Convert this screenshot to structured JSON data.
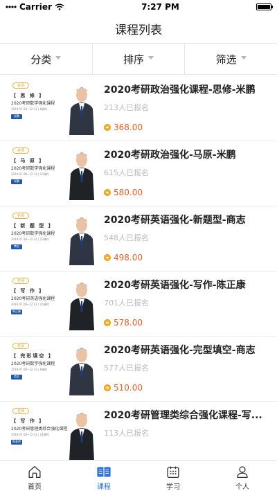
{
  "status_bar": {
    "carrier": "Carrier",
    "time": "7:27 PM"
  },
  "nav": {
    "title": "课程列表"
  },
  "filters": [
    "分类",
    "排序",
    "筛选"
  ],
  "courses": [
    {
      "tag": "名师",
      "topic": "【 思 修 】",
      "sub": "2020考研数学强化课程",
      "date": "2019.07.08~12.31 | 8课时",
      "badge": "米鹏",
      "title": "2020考研政治强化课程-思修-米鹏",
      "enrolled": "213人已报名",
      "price": "368.00"
    },
    {
      "tag": "名师",
      "topic": "【 马 原 】",
      "sub": "2020考研数学强化课程",
      "date": "2019.07.08~12.31 | 10课时",
      "badge": "米鹏",
      "title": "2020考研政治强化-马原-米鹏",
      "enrolled": "615人已报名",
      "price": "580.00"
    },
    {
      "tag": "名师",
      "topic": "【 新 题 型 】",
      "sub": "2020考研数学强化课程",
      "date": "2019.07.08~12.31 | 10课时",
      "badge": "商志",
      "title": "2020考研英语强化-新题型-商志",
      "enrolled": "548人已报名",
      "price": "498.00"
    },
    {
      "tag": "名师",
      "topic": "【 写 作 】",
      "sub": "2020考研英语强化课程",
      "date": "2019.07.08~12.31 | 16课时",
      "badge": "陈正康",
      "title": "2020考研英语强化-写作-陈正康",
      "enrolled": "701人已报名",
      "price": "578.00"
    },
    {
      "tag": "名师",
      "topic": "【 完形填空 】",
      "sub": "2020考研数学强化课程",
      "date": "2019.07.08~12.31 | 8课时",
      "badge": "商志",
      "title": "2020考研英语强化-完型填空-商志",
      "enrolled": "577人已报名",
      "price": "510.00"
    },
    {
      "tag": "名师",
      "topic": "【 写 作 】",
      "sub": "2020考研管理类综合强化课程",
      "date": "2019.07.08~12.31 | 24课时",
      "badge": "陈老师",
      "title": "2020考研管理类综合强化课程-写...",
      "enrolled": "113人已报名",
      "price": ""
    }
  ],
  "tabs": [
    {
      "label": "首页",
      "icon": "home-icon"
    },
    {
      "label": "课程",
      "icon": "book-icon"
    },
    {
      "label": "学习",
      "icon": "calendar-icon"
    },
    {
      "label": "个人",
      "icon": "person-icon"
    }
  ],
  "colors": {
    "accent": "#2a6fd6",
    "price": "#e2622b",
    "tag": "#d9a02e",
    "badge": "#2358a8"
  }
}
